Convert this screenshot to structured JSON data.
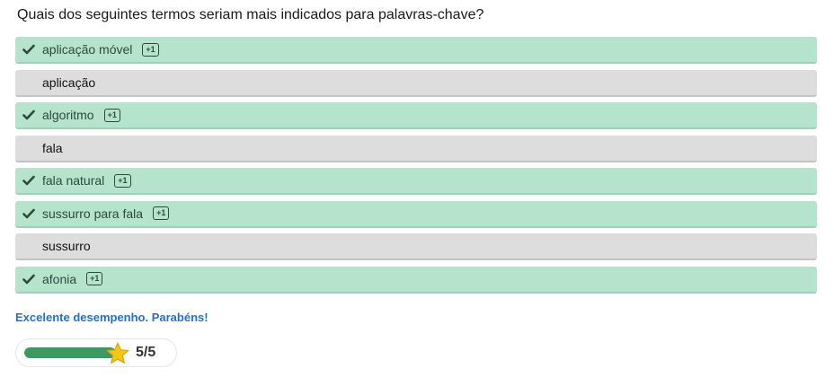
{
  "question": "Quais dos seguintes termos seriam mais indicados para palavras-chave?",
  "options": [
    {
      "label": "aplicação móvel",
      "correct": true,
      "badge": "+1"
    },
    {
      "label": "aplicação",
      "correct": false,
      "badge": ""
    },
    {
      "label": "algoritmo",
      "correct": true,
      "badge": "+1"
    },
    {
      "label": "fala",
      "correct": false,
      "badge": ""
    },
    {
      "label": "fala natural",
      "correct": true,
      "badge": "+1"
    },
    {
      "label": "sussurro para fala",
      "correct": true,
      "badge": "+1"
    },
    {
      "label": "sussurro",
      "correct": false,
      "badge": ""
    },
    {
      "label": "afonia",
      "correct": true,
      "badge": "+1"
    }
  ],
  "feedback": "Excelente desempenho. Parabéns!",
  "score": {
    "text": "5/5",
    "value": 5,
    "max": 5
  },
  "colors": {
    "correct_bg": "#b5e3cc",
    "neutral_bg": "#dddddd",
    "feedback": "#2a6fc0",
    "progress": "#3a9a62",
    "star": "#f5c518"
  },
  "icons": {
    "correct": "check-icon",
    "score": "star-icon"
  }
}
